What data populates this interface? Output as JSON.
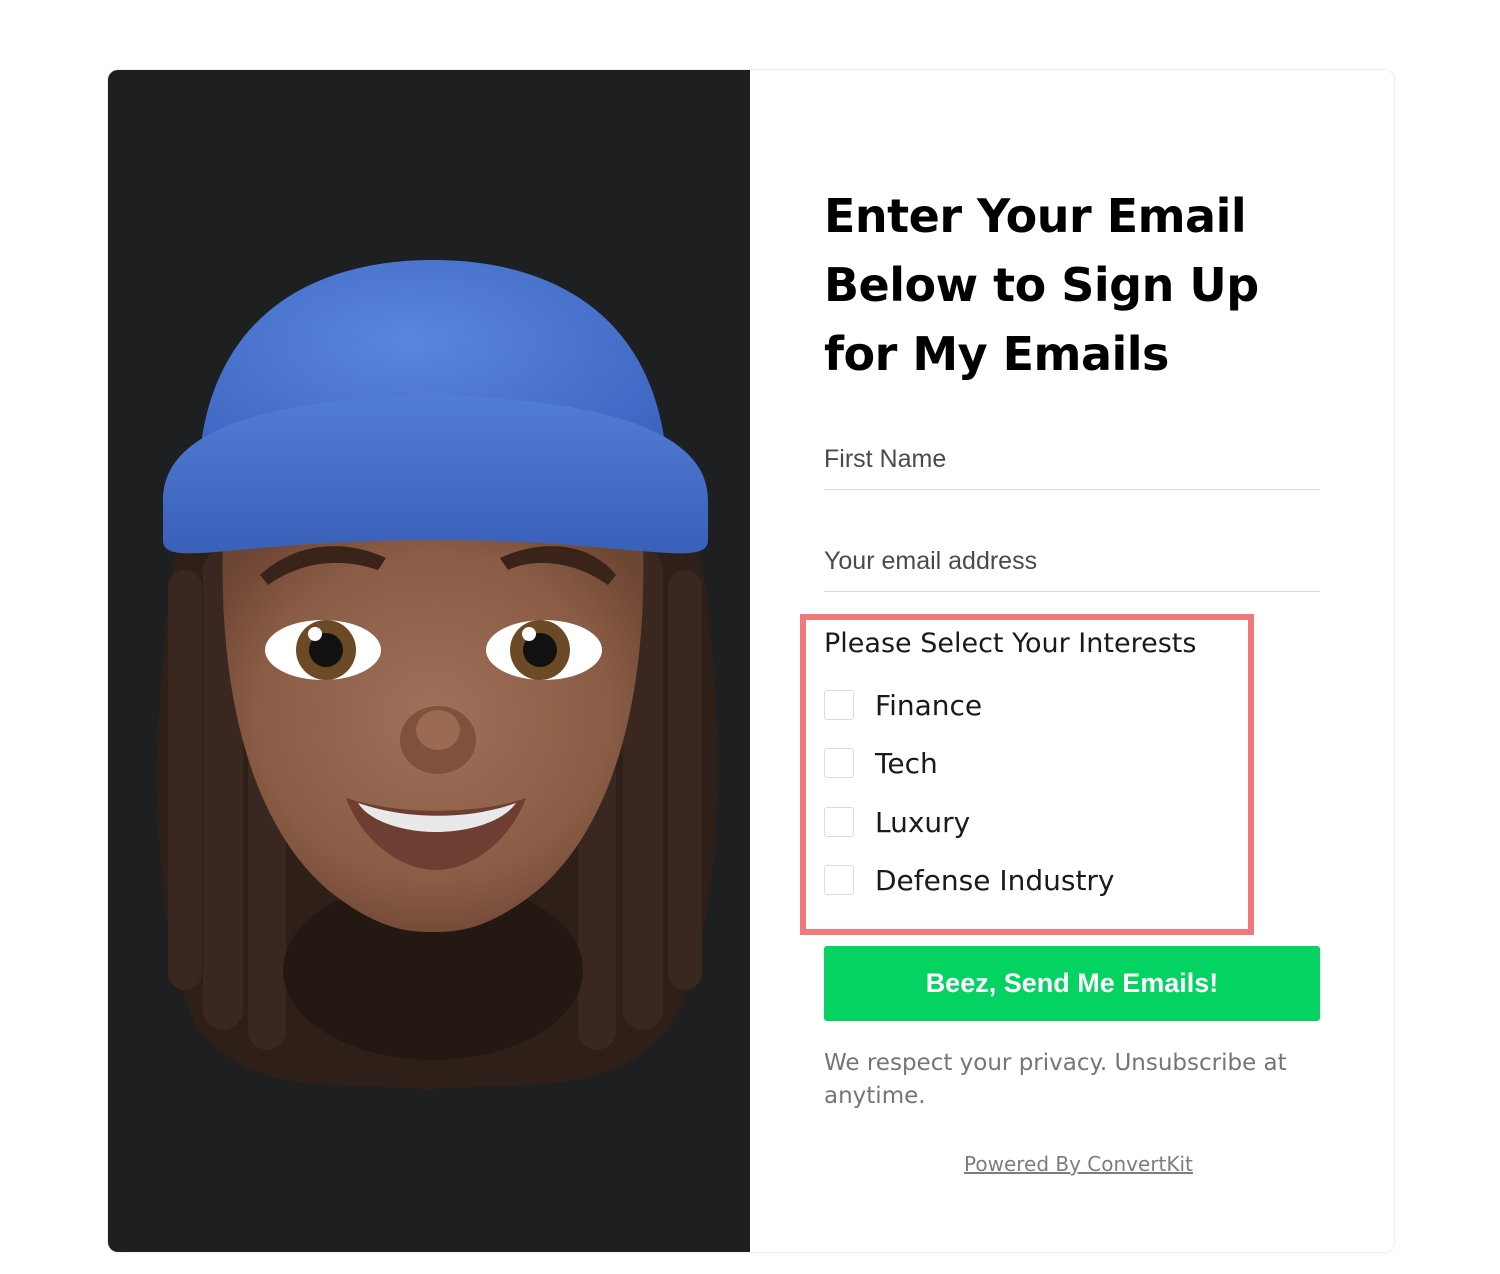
{
  "form": {
    "headline": "Enter Your Email Below to Sign Up for My Emails",
    "first_name_placeholder": "First Name",
    "email_placeholder": "Your email address",
    "interests_title": "Please Select Your Interests",
    "interests": [
      {
        "label": "Finance",
        "checked": false
      },
      {
        "label": "Tech",
        "checked": false
      },
      {
        "label": "Luxury",
        "checked": false
      },
      {
        "label": "Defense Industry",
        "checked": false
      }
    ],
    "submit_label": "Beez, Send Me Emails!",
    "privacy_text": "We respect your privacy. Unsubscribe at anytime.",
    "powered_by": "Powered By ConvertKit"
  },
  "image": {
    "subject": "memoji-avatar",
    "panel_color": "#1e1f21"
  },
  "colors": {
    "button": "#04d361",
    "highlight_border": "#f0787b",
    "headline": "#000000"
  }
}
